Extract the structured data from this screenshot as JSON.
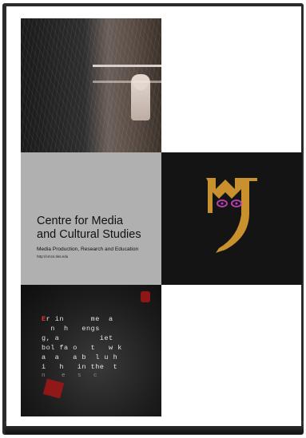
{
  "cover": {
    "title_line1": "Centre for Media",
    "title_line2": "and Cultural Studies",
    "subtitle": "Media Production, Research and Education",
    "url": "http://cmcs.tiss.edu"
  },
  "typography_tile": {
    "drop_cap": "E",
    "line1": "r in      me  a",
    "line2": "  n  h   engs",
    "line3": "g, a         iet",
    "line4": "bol fa o   t   w k",
    "line5": "a  a   a b  l u h",
    "line6": "i   h   in the  t",
    "faint_line": "n    e   s   c"
  },
  "colors": {
    "case": "#2b2b2b",
    "grey_tile": "#b0b0b0",
    "logo_tile": "#141414",
    "logo_gold": "#c8912e",
    "logo_eyes": "#b43fb0"
  }
}
